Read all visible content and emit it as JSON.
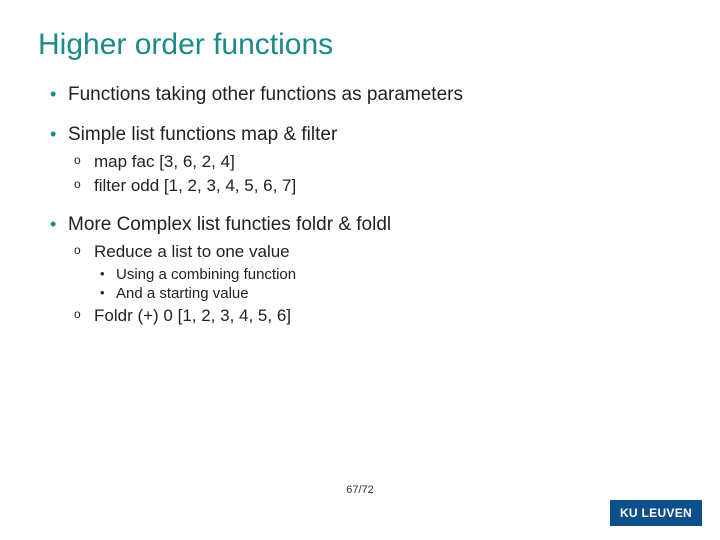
{
  "title": "Higher order functions",
  "bullets": [
    {
      "text": "Functions taking other functions as parameters",
      "sub": []
    },
    {
      "text": "Simple list functions map & filter",
      "sub": [
        {
          "text": "map fac [3, 6, 2, 4]"
        },
        {
          "text": "filter odd [1, 2, 3, 4, 5, 6, 7]"
        }
      ]
    },
    {
      "text": "More Complex list functies foldr & foldl",
      "sub": [
        {
          "text": "Reduce a list to one value",
          "subsub": [
            {
              "text": "Using a combining function"
            },
            {
              "text": "And a starting value"
            }
          ]
        },
        {
          "text": "Foldr (+) 0 [1, 2, 3, 4, 5, 6]"
        }
      ]
    }
  ],
  "page": "67/72",
  "logo": "KU LEUVEN"
}
